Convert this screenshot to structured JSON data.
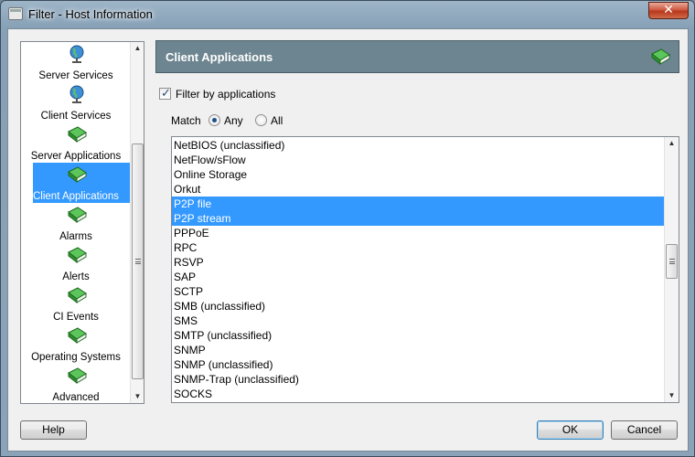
{
  "window": {
    "title": "Filter - Host Information",
    "close_label": "✕"
  },
  "nav": {
    "items": [
      {
        "label": "Server Services",
        "icon": "globe-icon"
      },
      {
        "label": "Client Services",
        "icon": "globe-icon"
      },
      {
        "label": "Server Applications",
        "icon": "book-icon"
      },
      {
        "label": "Client Applications",
        "icon": "book-icon",
        "selected": true
      },
      {
        "label": "Alarms",
        "icon": "book-icon"
      },
      {
        "label": "Alerts",
        "icon": "book-icon"
      },
      {
        "label": "CI Events",
        "icon": "book-icon"
      },
      {
        "label": "Operating Systems",
        "icon": "book-icon"
      },
      {
        "label": "Advanced",
        "icon": "book-icon"
      }
    ]
  },
  "header": {
    "title": "Client Applications",
    "icon": "book-icon"
  },
  "filter": {
    "label": "Filter by applications",
    "checked": true
  },
  "match": {
    "label": "Match",
    "options": [
      "Any",
      "All"
    ],
    "selected": "Any"
  },
  "applications": {
    "rows": [
      {
        "label": "NetBIOS (unclassified)"
      },
      {
        "label": "NetFlow/sFlow"
      },
      {
        "label": "Online Storage"
      },
      {
        "label": "Orkut"
      },
      {
        "label": "P2P file",
        "selected": true
      },
      {
        "label": "P2P stream",
        "selected": true
      },
      {
        "label": "PPPoE"
      },
      {
        "label": "RPC"
      },
      {
        "label": "RSVP"
      },
      {
        "label": "SAP"
      },
      {
        "label": "SCTP"
      },
      {
        "label": "SMB (unclassified)"
      },
      {
        "label": "SMS"
      },
      {
        "label": "SMTP (unclassified)"
      },
      {
        "label": "SNMP"
      },
      {
        "label": "SNMP (unclassified)"
      },
      {
        "label": "SNMP-Trap (unclassified)"
      },
      {
        "label": "SOCKS"
      }
    ]
  },
  "buttons": {
    "help": "Help",
    "ok": "OK",
    "cancel": "Cancel"
  },
  "colors": {
    "selection": "#3399ff",
    "header_bg": "#6d8590",
    "book_green": "#3aa23a"
  }
}
